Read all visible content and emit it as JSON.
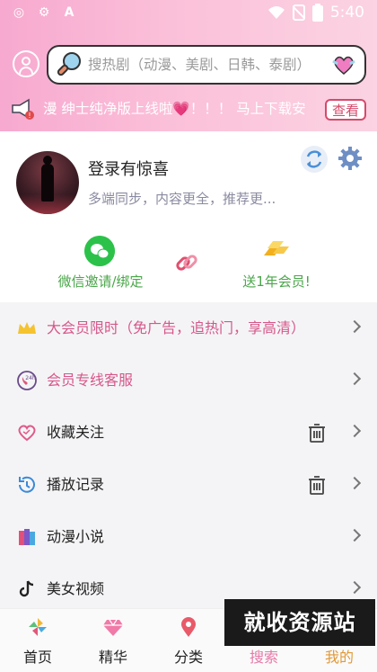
{
  "status_bar": {
    "time": "5:40",
    "left_icons": [
      "whatsapp-icon",
      "chip-icon",
      "a-icon"
    ],
    "right_icons": [
      "wifi-icon",
      "no-sim-icon",
      "battery-icon"
    ]
  },
  "header": {
    "search_placeholder": "搜热剧（动漫、美剧、日韩、泰剧）",
    "notice_text": "漫 绅士纯净版上线啦💗！！！  马上下载安",
    "notice_button": "查看"
  },
  "profile": {
    "title": "登录有惊喜",
    "subtitle": "多端同步，内容更全，推荐更...",
    "wechat_label": "微信邀请/绑定",
    "vip_label": "送1年会员!"
  },
  "menu": [
    {
      "label": "大会员限时（免广告，追热门，享高清）",
      "icon": "crown-icon",
      "style": "pink"
    },
    {
      "label": "会员专线客服",
      "icon": "24h-phone-icon",
      "style": "pink"
    },
    {
      "label": "收藏关注",
      "icon": "heart-icon",
      "has_delete": true
    },
    {
      "label": "播放记录",
      "icon": "history-icon",
      "has_delete": true
    },
    {
      "label": "动漫小说",
      "icon": "books-icon"
    },
    {
      "label": "美女视频",
      "icon": "tiktok-icon"
    }
  ],
  "tabs": [
    {
      "label": "首页",
      "icon": "pinwheel-icon"
    },
    {
      "label": "精华",
      "icon": "diamond-icon"
    },
    {
      "label": "分类",
      "icon": "location-pin-icon"
    },
    {
      "label": "搜索",
      "icon": "search-icon"
    },
    {
      "label": "我的",
      "icon": "user-icon",
      "active": true
    }
  ],
  "watermark": "就收资源站",
  "colors": {
    "header_pink": "#f7a9cf",
    "accent_pink": "#e57ba8",
    "green": "#2cc24a",
    "label_green": "#4aa64a"
  }
}
